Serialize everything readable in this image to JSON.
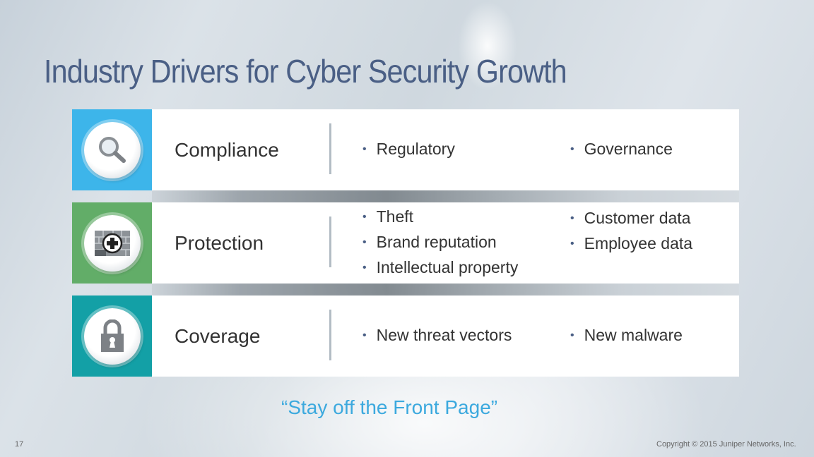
{
  "slide": {
    "title": "Industry Drivers for Cyber Security Growth",
    "tagline": "“Stay off the Front Page”",
    "page_number": "17",
    "copyright": "Copyright © 2015 Juniper Networks, Inc."
  },
  "colors": {
    "title": "#4a5f85",
    "tagline": "#3ca9de",
    "compliance_tile": "#3db5ea",
    "protection_tile": "#62ad68",
    "coverage_tile": "#13a0a6"
  },
  "rows": [
    {
      "category": "Compliance",
      "icon": "magnifier-icon",
      "col1": [
        "Regulatory"
      ],
      "col2": [
        "Governance"
      ]
    },
    {
      "category": "Protection",
      "icon": "firewall-plus-icon",
      "col1": [
        "Theft",
        "Brand reputation",
        "Intellectual property"
      ],
      "col2": [
        "Customer data",
        "Employee data"
      ]
    },
    {
      "category": "Coverage",
      "icon": "padlock-icon",
      "col1": [
        "New threat vectors"
      ],
      "col2": [
        "New malware"
      ]
    }
  ],
  "bullet": "•"
}
